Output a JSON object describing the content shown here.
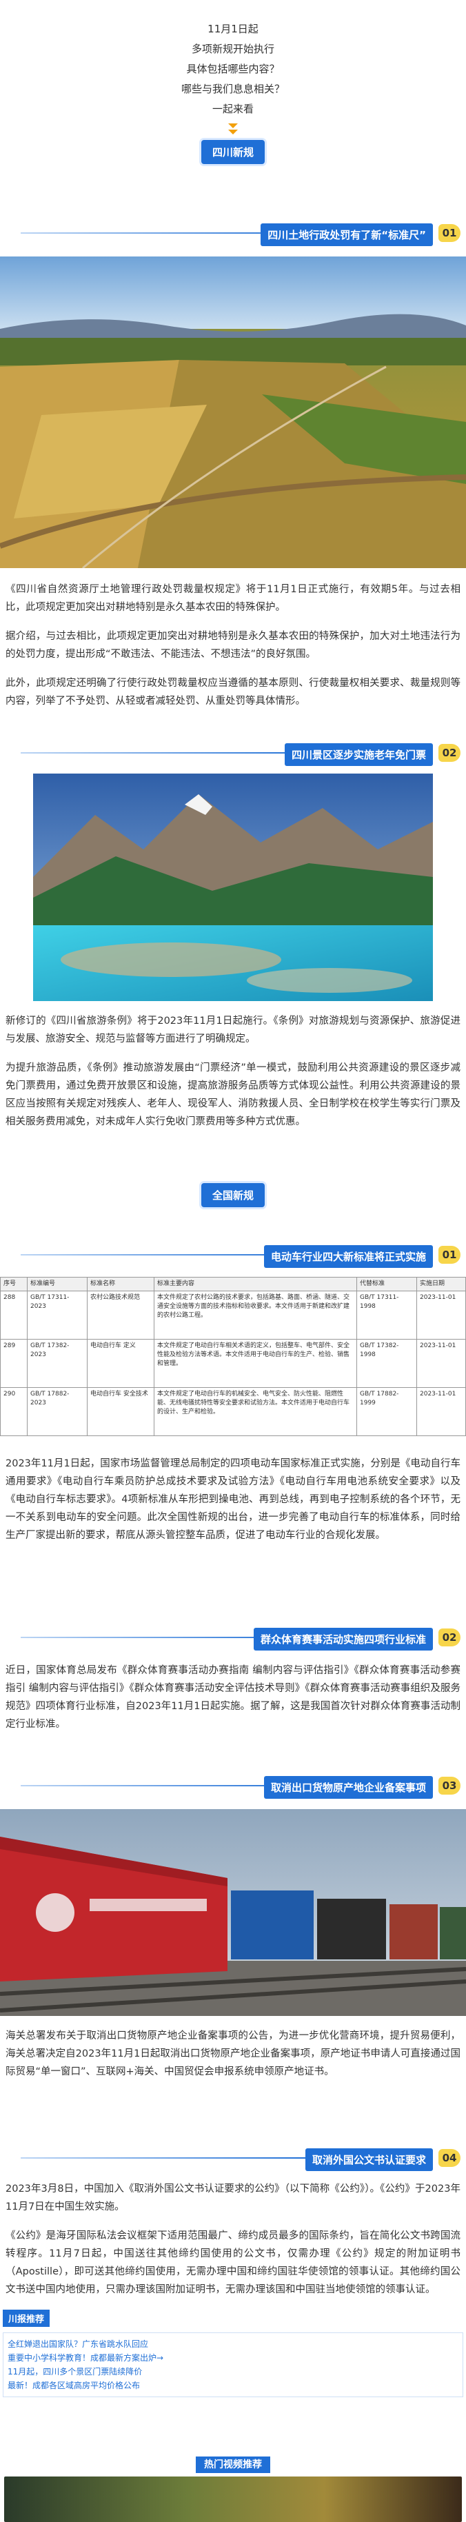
{
  "intro": {
    "lines": [
      "11月1日起",
      "多项新规开始执行",
      "具体包括哪些内容？",
      "哪些与我们息息相关？",
      "一起来看"
    ],
    "pill": "四川新规"
  },
  "s1": {
    "label": "四川土地行政处罚有了新“标准尺”",
    "num": "01",
    "paras": [
      "《四川省自然资源厅土地管理行政处罚裁量权规定》将于11月1日正式施行，有效期5年。与过去相比，此项规定更加突出对耕地特别是永久基本农田的特殊保护。",
      "据介绍，与过去相比，此项规定更加突出对耕地特别是永久基本农田的特殊保护，加大对土地违法行为的处罚力度，提出形成“不敢违法、不能违法、不想违法”的良好氛围。",
      "此外，此项规定还明确了行使行政处罚裁量权应当遵循的基本原则、行使裁量权相关要求、裁量规则等内容，列举了不予处罚、从轻或者减轻处罚、从重处罚等具体情形。"
    ]
  },
  "s2": {
    "label": "四川景区逐步实施老年免门票",
    "num": "02",
    "paras": [
      "新修订的《四川省旅游条例》将于2023年11月1日起施行。《条例》对旅游规划与资源保护、旅游促进与发展、旅游安全、规范与监督等方面进行了明确规定。",
      "为提升旅游品质，《条例》推动旅游发展由“门票经济”单一模式，鼓励利用公共资源建设的景区逐步减免门票费用，通过免费开放景区和设施，提高旅游服务品质等方式体现公益性。利用公共资源建设的景区应当按照有关规定对残疾人、老年人、现役军人、消防救援人员、全日制学校在校学生等实行门票及相关服务费用减免，对未成年人实行免收门票费用等多种方式优惠。"
    ]
  },
  "national_pill": "全国新规",
  "s3": {
    "label": "电动车行业四大新标准将正式实施",
    "num": "01",
    "table": {
      "headers": [
        "序号",
        "标准编号",
        "标准名称",
        "标准主要内容",
        "代替标准",
        "实施日期"
      ],
      "rows": [
        [
          "288",
          "GB/T 17311-2023",
          "农村公路技术规范",
          "本文件规定了农村公路的技术要求，包括路基、路面、桥涵、隧道、交通安全设施等方面的技术指标和验收要求。本文件适用于新建和改扩建的农村公路工程。",
          "GB/T 17311-1998",
          "2023-11-01"
        ],
        [
          "289",
          "GB/T 17382-2023",
          "电动自行车 定义",
          "本文件规定了电动自行车相关术语的定义，包括整车、电气部件、安全性能及检验方法等术语。本文件适用于电动自行车的生产、检验、销售和管理。",
          "GB/T 17382-1998",
          "2023-11-01"
        ],
        [
          "290",
          "GB/T 17882-2023",
          "电动自行车 安全技术",
          "本文件规定了电动自行车的机械安全、电气安全、防火性能、阻燃性能、无线电骚扰特性等安全要求和试验方法。本文件适用于电动自行车的设计、生产和检验。",
          "GB/T 17882-1999",
          "2023-11-01"
        ]
      ]
    },
    "para": "2023年11月1日起，国家市场监督管理总局制定的四项电动车国家标准正式实施，分别是《电动自行车通用要求》《电动自行车乘员防护总成技术要求及试验方法》《电动自行车用电池系统安全要求》以及《电动自行车标志要求》。4项新标准从车形把到操电池、再到总线，再到电子控制系统的各个环节，无一不关系到电动车的安全问题。此次全国性新规的出台，进一步完善了电动自行车的标准体系，同时给生产厂家提出新的要求，帮底从源头管控整车品质，促进了电动车行业的合规化发展。"
  },
  "s4": {
    "label": "群众体育赛事活动实施四项行业标准",
    "num": "02",
    "para": "近日，国家体育总局发布《群众体育赛事活动办赛指南 编制内容与评估指引》《群众体育赛事活动参赛指引 编制内容与评估指引》《群众体育赛事活动安全评估技术导则》《群众体育赛事活动赛事组织及服务规范》四项体育行业标准，自2023年11月1日起实施。据了解，这是我国首次针对群众体育赛事活动制定行业标准。"
  },
  "s5": {
    "label": "取消出口货物原产地企业备案事项",
    "num": "03",
    "para": "海关总署发布关于取消出口货物原产地企业备案事项的公告，为进一步优化营商环境，提升贸易便利，海关总署决定自2023年11月1日起取消出口货物原产地企业备案事项，原产地证书申请人可直接通过国际贸易“单一窗口”、互联网+海关、中国贸促会申报系统申领原产地证书。"
  },
  "s6": {
    "label": "取消外国公文书认证要求",
    "num": "04",
    "paras": [
      "2023年3月8日，中国加入《取消外国公文书认证要求的公约》（以下简称《公约》）。《公约》于2023年11月7日在中国生效实施。",
      "《公约》是海牙国际私法会议框架下适用范围最广、缔约成员最多的国际条约，旨在简化公文书跨国流转程序。11月7日起，中国送往其他缔约国使用的公文书，仅需办理《公约》规定的附加证明书（Apostille），即可送其他缔约国使用，无需办理中国和缔约国驻华使领馆的领事认证。其他缔约国公文书送中国内地使用，只需办理该国附加证明书，无需办理该国和中国驻当地使领馆的领事认证。"
    ]
  },
  "recommend": {
    "tag": "川报推荐",
    "lines": [
      "全红婵退出国家队？广东省跳水队回应",
      "重要中小学科学教育！成都最新方案出炉→",
      "11月起，四川多个景区门票陆续降价",
      "最新！成都各区域高房平均价格公布"
    ]
  },
  "video": {
    "label": "热门视频推荐"
  },
  "colors": {
    "accent": "#1f6fd6",
    "badge": "#f7d54a",
    "arrow": "#f2a00c"
  }
}
